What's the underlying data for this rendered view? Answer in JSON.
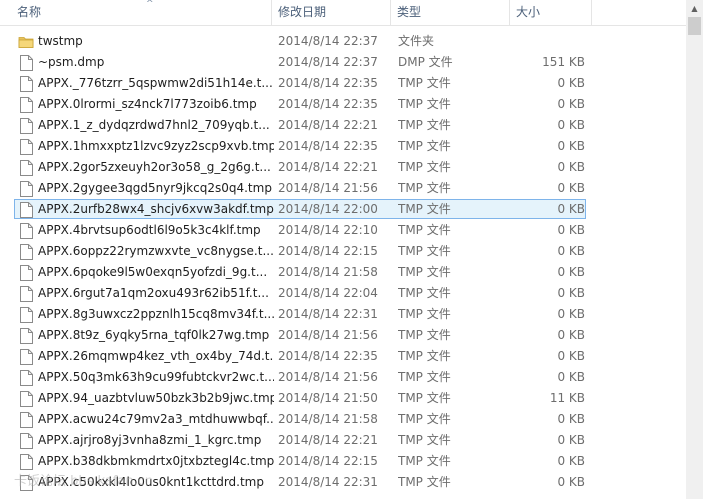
{
  "columns": {
    "name": "名称",
    "date": "修改日期",
    "type": "类型",
    "size": "大小"
  },
  "watermark": "卡饭论坛 bbs.kafan.cn",
  "rows": [
    {
      "name": "twstmp",
      "date": "2014/8/14 22:37",
      "type": "文件夹",
      "size": "",
      "icon": "folder-icon"
    },
    {
      "name": "~psm.dmp",
      "date": "2014/8/14 22:37",
      "type": "DMP 文件",
      "size": "151 KB",
      "icon": "file-icon"
    },
    {
      "name": "APPX._776tzrr_5qspwmw2di51h14e.t...",
      "date": "2014/8/14 22:35",
      "type": "TMP 文件",
      "size": "0 KB",
      "icon": "file-icon"
    },
    {
      "name": "APPX.0lrormi_sz4nck7l773zoib6.tmp",
      "date": "2014/8/14 22:35",
      "type": "TMP 文件",
      "size": "0 KB",
      "icon": "file-icon"
    },
    {
      "name": "APPX.1_z_dydqzrdwd7hnl2_709yqb.t...",
      "date": "2014/8/14 22:21",
      "type": "TMP 文件",
      "size": "0 KB",
      "icon": "file-icon"
    },
    {
      "name": "APPX.1hmxxptz1lzvc9zyz2scp9xvb.tmp",
      "date": "2014/8/14 22:35",
      "type": "TMP 文件",
      "size": "0 KB",
      "icon": "file-icon"
    },
    {
      "name": "APPX.2gor5zxeuyh2or3o58_g_2g6g.t...",
      "date": "2014/8/14 22:21",
      "type": "TMP 文件",
      "size": "0 KB",
      "icon": "file-icon"
    },
    {
      "name": "APPX.2gygee3qgd5nyr9jkcq2s0q4.tmp",
      "date": "2014/8/14 21:56",
      "type": "TMP 文件",
      "size": "0 KB",
      "icon": "file-icon"
    },
    {
      "name": "APPX.2urfb28wx4_shcjv6xvw3akdf.tmp",
      "date": "2014/8/14 22:00",
      "type": "TMP 文件",
      "size": "0 KB",
      "icon": "file-icon",
      "selected": true
    },
    {
      "name": "APPX.4brvtsup6odtl6l9o5k3c4klf.tmp",
      "date": "2014/8/14 22:10",
      "type": "TMP 文件",
      "size": "0 KB",
      "icon": "file-icon"
    },
    {
      "name": "APPX.6oppz22rymzwxvte_vc8nygse.t...",
      "date": "2014/8/14 22:15",
      "type": "TMP 文件",
      "size": "0 KB",
      "icon": "file-icon"
    },
    {
      "name": "APPX.6pqoke9l5w0exqn5yofzdi_9g.t...",
      "date": "2014/8/14 21:58",
      "type": "TMP 文件",
      "size": "0 KB",
      "icon": "file-icon"
    },
    {
      "name": "APPX.6rgut7a1qm2oxu493r62ib51f.t...",
      "date": "2014/8/14 22:04",
      "type": "TMP 文件",
      "size": "0 KB",
      "icon": "file-icon"
    },
    {
      "name": "APPX.8g3uwxcz2ppznlh15cq8mv34f.t...",
      "date": "2014/8/14 22:31",
      "type": "TMP 文件",
      "size": "0 KB",
      "icon": "file-icon"
    },
    {
      "name": "APPX.8t9z_6yqky5rna_tqf0lk27wg.tmp",
      "date": "2014/8/14 21:56",
      "type": "TMP 文件",
      "size": "0 KB",
      "icon": "file-icon"
    },
    {
      "name": "APPX.26mqmwp4kez_vth_ox4by_74d.t...",
      "date": "2014/8/14 22:35",
      "type": "TMP 文件",
      "size": "0 KB",
      "icon": "file-icon"
    },
    {
      "name": "APPX.50q3mk63h9cu99fubtckvr2wc.t...",
      "date": "2014/8/14 21:56",
      "type": "TMP 文件",
      "size": "0 KB",
      "icon": "file-icon"
    },
    {
      "name": "APPX.94_uazbtvluw50bzk3b2b9jwc.tmp",
      "date": "2014/8/14 21:50",
      "type": "TMP 文件",
      "size": "11 KB",
      "icon": "file-icon"
    },
    {
      "name": "APPX.acwu24c79mv2a3_mtdhuwwbqf....",
      "date": "2014/8/14 21:58",
      "type": "TMP 文件",
      "size": "0 KB",
      "icon": "file-icon"
    },
    {
      "name": "APPX.ajrjro8yj3vnha8zmi_1_kgrc.tmp",
      "date": "2014/8/14 22:21",
      "type": "TMP 文件",
      "size": "0 KB",
      "icon": "file-icon"
    },
    {
      "name": "APPX.b38dkbmkmdrtx0jtxbztegl4c.tmp",
      "date": "2014/8/14 22:15",
      "type": "TMP 文件",
      "size": "0 KB",
      "icon": "file-icon"
    },
    {
      "name": "APPX.c50kxkl4lo0us0knt1kcttdrd.tmp",
      "date": "2014/8/14 22:31",
      "type": "TMP 文件",
      "size": "0 KB",
      "icon": "file-icon"
    }
  ]
}
